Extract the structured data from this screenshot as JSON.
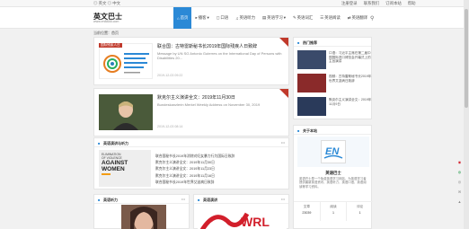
{
  "topbar": {
    "left": "◎ 英文 ◎ 中文",
    "links": [
      "注册登录",
      "联系我们",
      "订阅本站",
      "帮助"
    ]
  },
  "header": {
    "logo_title": "英文巴士",
    "logo_sub": "www.en8848.com"
  },
  "nav": [
    {
      "label": "首页",
      "icon": "home-icon",
      "active": true
    },
    {
      "label": "播客",
      "icon": "podcast-icon",
      "active": false
    },
    {
      "label": "口语",
      "icon": "chat-icon",
      "active": false
    },
    {
      "label": "英语听力",
      "icon": "headphone-icon",
      "active": false
    },
    {
      "label": "英语学习",
      "icon": "book-icon",
      "active": false
    },
    {
      "label": "英语词汇",
      "icon": "pen-icon",
      "active": false
    },
    {
      "label": "英语阅读",
      "icon": "read-icon",
      "active": false
    },
    {
      "label": "英语翻译",
      "icon": "translate-icon",
      "active": false
    }
  ],
  "search_icon": "search-icon",
  "breadcrumb": "当前位置：首页",
  "posts": [
    {
      "tag": "国际残疾人日",
      "title": "联合国：古特雷斯秘书长2019年国际残疾人日致辞",
      "desc": "Message by UN SG Antonio Guterres on the International Day of Persons with Disabilities 20...",
      "date": "2019-12-03 09:22"
    },
    {
      "tag": "",
      "title": "默克尔主义演讲全文：2019年11月30日",
      "desc": "Bundeskanzlerin Merkel Weekly Address on November 30, 2019",
      "date": "2019-12-03 08:14"
    }
  ],
  "feature_box": {
    "title": "英语演讲与听力",
    "thumb_lines": [
      "ELIMINATION",
      "OF VIOLENCE",
      "AGAINST",
      "WOMEN"
    ],
    "items": [
      "联合国秘书长2019年消除对妇女暴力行为国际日致辞",
      "默克尔主义演讲全文：2019年11月30日",
      "默克尔主义演讲全文：2019年11月23日",
      "默克尔主义演讲全文：2019年11月16日",
      "联合国秘书长2019年世界艾滋病日致辞",
      "默克尔主义演讲全文：2019年11月9日"
    ]
  },
  "bottom_boxes": [
    {
      "title": "英语听力"
    },
    {
      "title": "英语演讲"
    }
  ],
  "side_hot": {
    "title": "热门推荐",
    "items": [
      "口语：习近平主席在第二届中国国际进口博览会开幕式上的主旨演讲",
      "视频：古特雷斯秘书长2019年世界艾滋病日致辞",
      "默克尔主义演讲全文：2019年11月9日"
    ]
  },
  "side_about": {
    "title": "关于本站",
    "name": "英语巴士",
    "text": "英语巴士是一个免费英语学习网站，为英语学习者提供最新英语资讯、英语听力、英语口语、英语阅读等学习资料。",
    "stats": [
      {
        "label": "文章",
        "value": "23039"
      },
      {
        "label": "阅读",
        "value": "1"
      },
      {
        "label": "评论",
        "value": "1"
      }
    ]
  },
  "toolbar_icons": [
    "weibo-icon",
    "wechat-icon",
    "qq-icon",
    "comment-icon",
    "top-icon"
  ]
}
